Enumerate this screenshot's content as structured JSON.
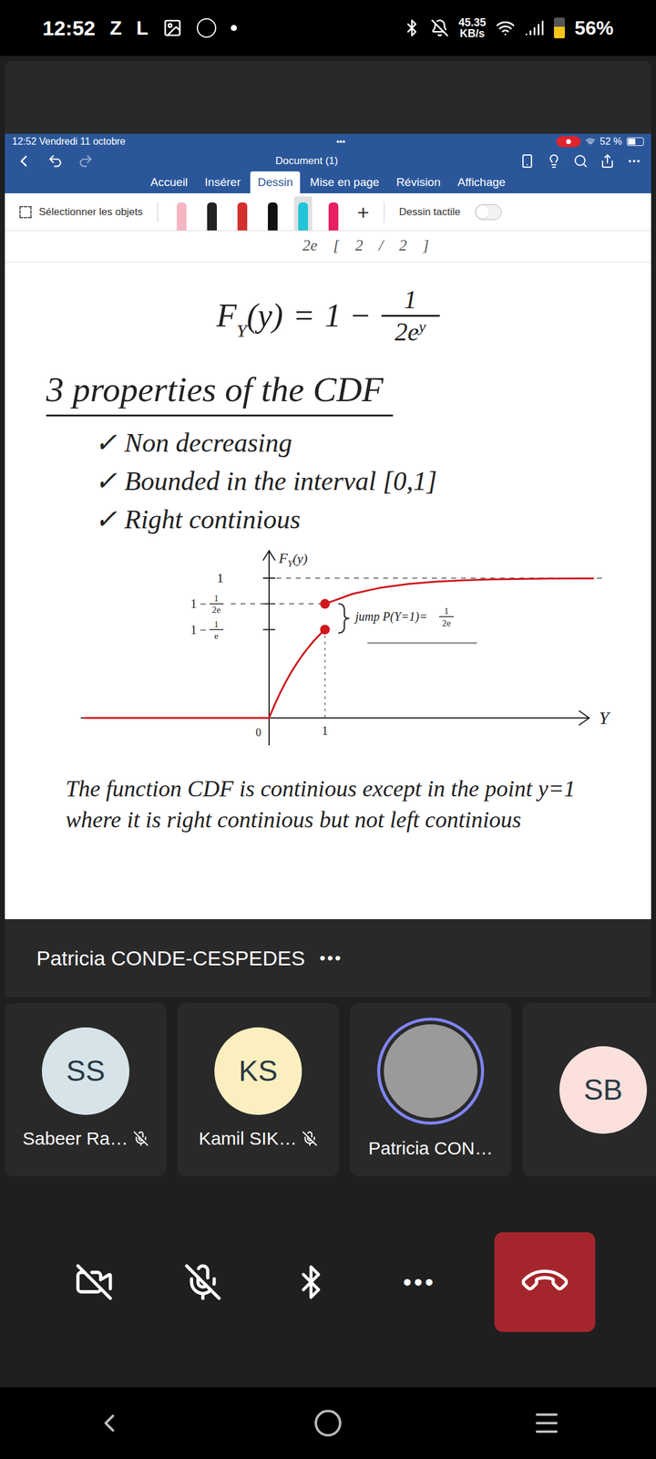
{
  "status_bar": {
    "time": "12:52",
    "left_icons": [
      "Z",
      "L"
    ],
    "speed": "45.35",
    "speed_unit": "KB/s",
    "battery": "56%",
    "battery_level": 0.56
  },
  "ipad_bar": {
    "datetime": "12:52  Vendredi 11 octobre",
    "dots": "•••",
    "battery": "52 %",
    "battery_level": 0.52,
    "recording": true
  },
  "word": {
    "title": "Document (1)",
    "tabs": [
      {
        "label": "Accueil",
        "selected": false
      },
      {
        "label": "Insérer",
        "selected": false
      },
      {
        "label": "Dessin",
        "selected": true
      },
      {
        "label": "Mise en page",
        "selected": false
      },
      {
        "label": "Révision",
        "selected": false
      },
      {
        "label": "Affichage",
        "selected": false
      }
    ],
    "ribbon": {
      "select_label": "Sélectionner les objets",
      "add": "+",
      "touch_label": "Dessin tactile",
      "touch_on": false,
      "tools": [
        {
          "color": "#f4b6c2",
          "selected": false
        },
        {
          "color": "#222222",
          "selected": false
        },
        {
          "color": "#d32f2f",
          "selected": false
        },
        {
          "color": "#111111",
          "selected": false
        },
        {
          "color": "#22c4d8",
          "selected": true
        },
        {
          "color": "#e91e63",
          "selected": false
        }
      ]
    }
  },
  "document": {
    "top_fragment": "2e    [    2    /    2    ]",
    "formula": {
      "lhs": "F",
      "sub": "Y",
      "arg": "(y)",
      "eq": "=",
      "lead": "1 −",
      "num": "1",
      "den": "2e",
      "sup": "y"
    },
    "heading": "3 properties of the CDF",
    "checklist": [
      {
        "mark": "✓",
        "text": "Non decreasing",
        "checked": true
      },
      {
        "mark": "✓",
        "text": "Bounded in the interval [0,1]",
        "checked": true
      },
      {
        "mark": "✓",
        "text": "Right continious",
        "checked": true
      }
    ],
    "chart": {
      "y_label": {
        "main": "F",
        "sub": "Y",
        "arg": "(y)"
      },
      "x_label": "Y",
      "origin": "0",
      "x_ticks": [
        {
          "value": 1,
          "label": "1"
        }
      ],
      "y_ticks": [
        {
          "value": 1,
          "kind": "plain",
          "lead": "1",
          "num": "",
          "den": "",
          "dashed": true
        },
        {
          "value": 0.816,
          "kind": "fraction",
          "lead": "1 −",
          "num": "1",
          "den": "2e",
          "dashed": true
        },
        {
          "value": 0.632,
          "kind": "fraction",
          "lead": "1 −",
          "num": "1",
          "den": "e",
          "dashed": false
        }
      ],
      "series": [
        {
          "x": [
            -3.3,
            0
          ],
          "y": [
            0,
            0
          ]
        },
        {
          "x": [
            0,
            0.1,
            0.2,
            0.3,
            0.4,
            0.5,
            0.6,
            0.7,
            0.8,
            0.9,
            1
          ],
          "y": [
            0,
            0.095,
            0.181,
            0.259,
            0.33,
            0.393,
            0.451,
            0.503,
            0.551,
            0.593,
            0.632
          ]
        },
        {
          "x": [
            1,
            1.5,
            2,
            2.5,
            3,
            3.5,
            4,
            5,
            5.8
          ],
          "y": [
            0.816,
            0.888,
            0.932,
            0.959,
            0.975,
            0.985,
            0.991,
            0.997,
            0.998
          ]
        }
      ],
      "points": [
        {
          "x": 1,
          "y": 0.816,
          "filled": true
        },
        {
          "x": 1,
          "y": 0.632,
          "filled": true
        }
      ],
      "jump": {
        "text": "jump P(Y=1)=",
        "num": "1",
        "den": "2e",
        "from": 0.632,
        "to": 0.816
      }
    },
    "caption": "The function CDF is continious except in the point y=1 where it is right continious but not left continious"
  },
  "presenter": {
    "name": "Patricia CONDE-CESPEDES",
    "more": "•••"
  },
  "participants": [
    {
      "kind": "avatar",
      "initials": "SS",
      "name": "Sabeer Ra…",
      "muted": true,
      "speaking": false,
      "color": "#d6e4ea"
    },
    {
      "kind": "avatar",
      "initials": "KS",
      "name": "Kamil SIK…",
      "muted": true,
      "speaking": false,
      "color": "#fbefc0"
    },
    {
      "kind": "photo",
      "initials": "",
      "name": "Patricia CON…",
      "muted": false,
      "speaking": true,
      "color": "#9a9a9a"
    },
    {
      "kind": "avatar",
      "initials": "SB",
      "name": "",
      "muted": false,
      "speaking": false,
      "color": "#fbe0dc"
    }
  ],
  "controls": {
    "camera_on": false,
    "mic_on": false,
    "more": "•••"
  }
}
